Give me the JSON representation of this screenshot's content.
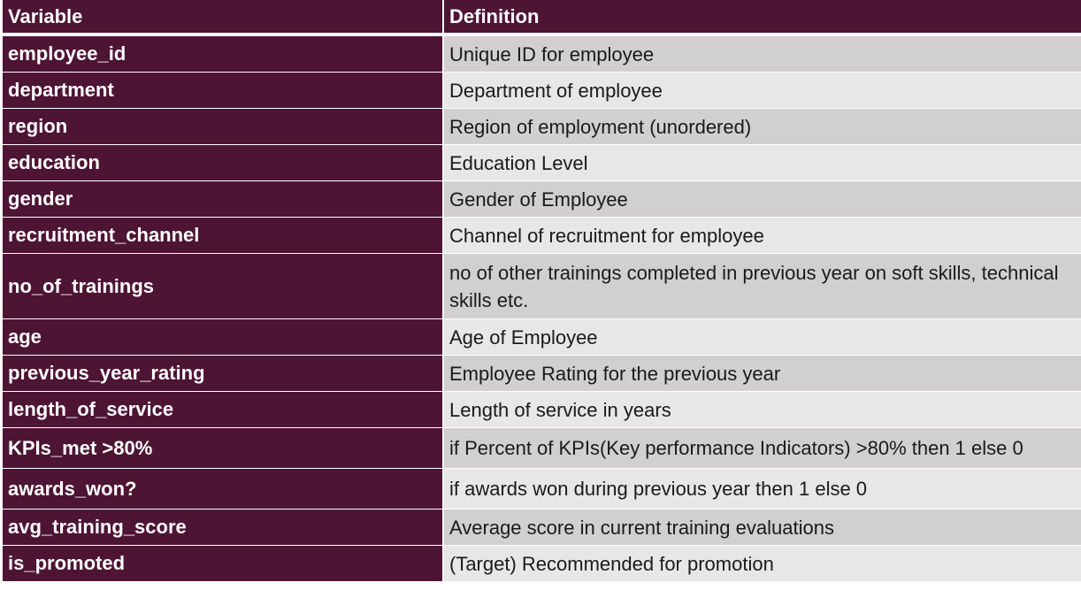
{
  "header": {
    "variable": "Variable",
    "definition": "Definition"
  },
  "rows": [
    {
      "variable": "employee_id",
      "definition": "Unique ID for employee"
    },
    {
      "variable": "department",
      "definition": "Department of employee"
    },
    {
      "variable": "region",
      "definition": "Region of employment (unordered)"
    },
    {
      "variable": "education",
      "definition": "Education Level"
    },
    {
      "variable": "gender",
      "definition": "Gender of Employee"
    },
    {
      "variable": "recruitment_channel",
      "definition": "Channel of recruitment for employee"
    },
    {
      "variable": "no_of_trainings",
      "definition": "no of other trainings completed in previous year on soft skills, technical skills etc."
    },
    {
      "variable": "age",
      "definition": "Age of Employee"
    },
    {
      "variable": "previous_year_rating",
      "definition": "Employee Rating for the previous year"
    },
    {
      "variable": "length_of_service",
      "definition": "Length of service in years"
    },
    {
      "variable": "KPIs_met >80%",
      "definition": "if Percent of KPIs(Key performance Indicators) >80% then 1 else 0"
    },
    {
      "variable": "awards_won?",
      "definition": "if awards won during previous year then 1 else 0"
    },
    {
      "variable": "avg_training_score",
      "definition": "Average score in current training evaluations"
    },
    {
      "variable": "is_promoted",
      "definition": "(Target) Recommended for promotion"
    }
  ],
  "colors": {
    "header_bg": "#4d1434",
    "row_bg_a": "#d2cfd0",
    "row_bg_b": "#e8e7e7"
  }
}
